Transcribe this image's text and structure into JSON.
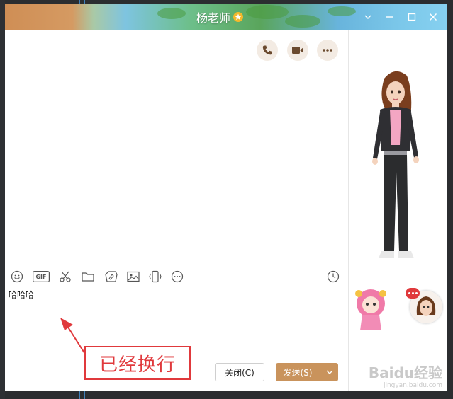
{
  "window": {
    "title": "杨老师",
    "controls": [
      "chevron-down-icon",
      "minimize-icon",
      "maximize-icon",
      "close-icon"
    ]
  },
  "call_actions": [
    {
      "name": "voice-call-button",
      "icon": "phone-icon"
    },
    {
      "name": "video-call-button",
      "icon": "video-camera-icon"
    },
    {
      "name": "more-button",
      "icon": "ellipsis-icon"
    }
  ],
  "toolbar": {
    "gif_label": "GIF",
    "tools": [
      "emoji-icon",
      "gif-icon",
      "scissors-icon",
      "folder-icon",
      "doodle-icon",
      "image-icon",
      "shake-icon",
      "more-icon"
    ],
    "history_icon": "clock-icon"
  },
  "input": {
    "text": "哈哈哈"
  },
  "annotation": {
    "text": "已经换行"
  },
  "buttons": {
    "close_label": "关闭(C)",
    "send_label": "发送(S)"
  },
  "watermark": {
    "logo": "Baidu经验",
    "url": "jingyan.baidu.com"
  },
  "colors": {
    "accent": "#c9935c",
    "annotation_red": "#e0393c",
    "call_button_bg": "#f3ebe3"
  }
}
